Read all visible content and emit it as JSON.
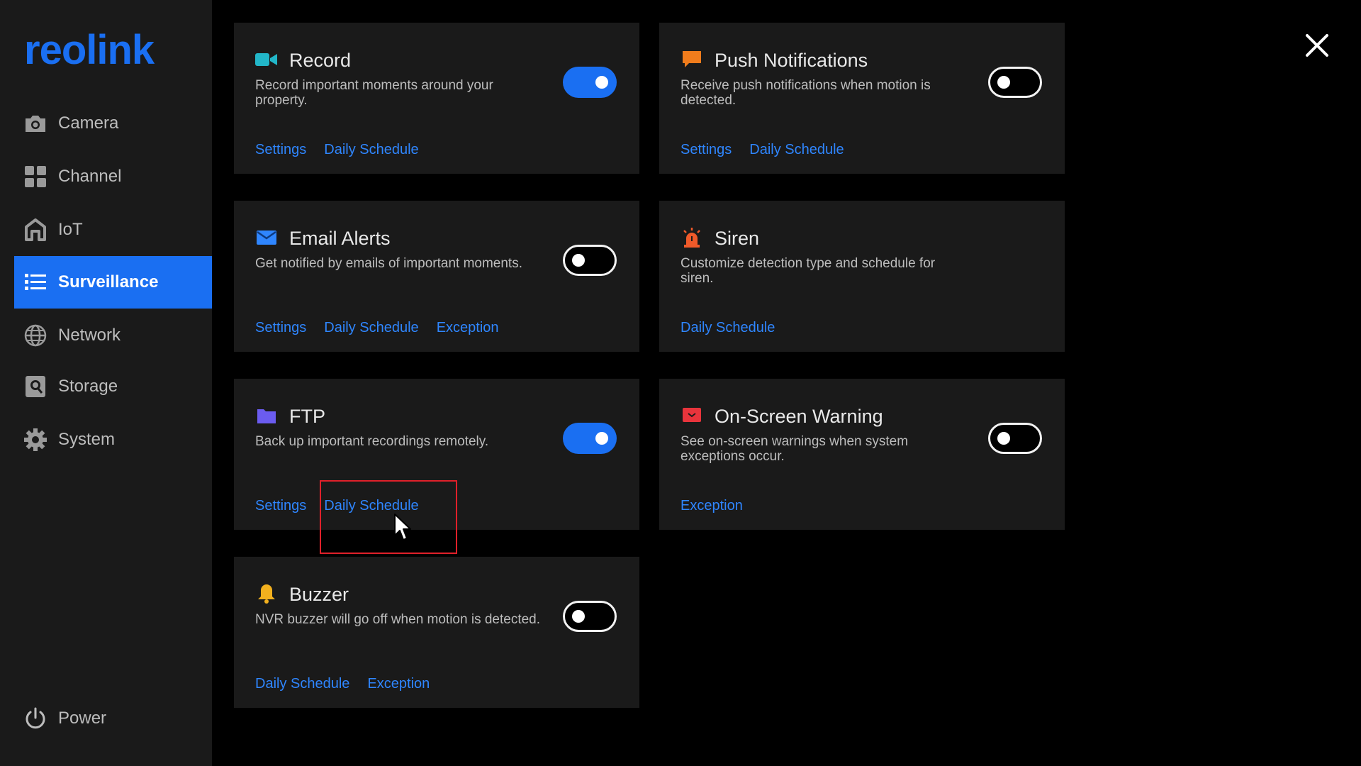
{
  "app": {
    "logo_text": "reolink"
  },
  "sidebar": {
    "items": [
      {
        "label": "Camera",
        "icon": "camera-icon",
        "active": false
      },
      {
        "label": "Channel",
        "icon": "grid-icon",
        "active": false
      },
      {
        "label": "IoT",
        "icon": "home-icon",
        "active": false
      },
      {
        "label": "Surveillance",
        "icon": "list-icon",
        "active": true
      },
      {
        "label": "Network",
        "icon": "globe-icon",
        "active": false
      },
      {
        "label": "Storage",
        "icon": "storage-icon",
        "active": false
      },
      {
        "label": "System",
        "icon": "gear-icon",
        "active": false
      }
    ],
    "power_label": "Power"
  },
  "cards": {
    "record": {
      "title": "Record",
      "description": "Record important moments around your property.",
      "enabled": true,
      "links": [
        "Settings",
        "Daily Schedule"
      ],
      "icon": "video-icon",
      "icon_color": "#22b6c8"
    },
    "push": {
      "title": "Push Notifications",
      "description": "Receive push notifications when motion is detected.",
      "enabled": false,
      "links": [
        "Settings",
        "Daily Schedule"
      ],
      "icon": "chat-icon",
      "icon_color": "#f07c1c"
    },
    "email": {
      "title": "Email Alerts",
      "description": "Get notified by emails of important moments.",
      "enabled": false,
      "links": [
        "Settings",
        "Daily Schedule",
        "Exception"
      ],
      "icon": "mail-icon",
      "icon_color": "#2f86ff"
    },
    "siren": {
      "title": "Siren",
      "description": "Customize detection type and schedule for siren.",
      "links": [
        "Daily Schedule"
      ],
      "icon": "siren-icon",
      "icon_color": "#f05a2a"
    },
    "ftp": {
      "title": "FTP",
      "description": "Back up important recordings remotely.",
      "enabled": true,
      "links": [
        "Settings",
        "Daily Schedule"
      ],
      "icon": "folder-icon",
      "icon_color": "#6b5cf0"
    },
    "warning": {
      "title": "On-Screen Warning",
      "description": "See on-screen warnings when system exceptions occur.",
      "enabled": false,
      "links": [
        "Exception"
      ],
      "icon": "screen-warning-icon",
      "icon_color": "#e8343c"
    },
    "buzzer": {
      "title": "Buzzer",
      "description": "NVR buzzer will go off when motion is detected.",
      "enabled": false,
      "links": [
        "Daily Schedule",
        "Exception"
      ],
      "icon": "bell-icon",
      "icon_color": "#f2b01e"
    }
  },
  "colors": {
    "accent": "#1a6ff2",
    "link": "#2f86ff",
    "card_bg": "#1a1a1a",
    "sidebar_bg": "#1a1a1a",
    "highlight": "#e0202a"
  }
}
